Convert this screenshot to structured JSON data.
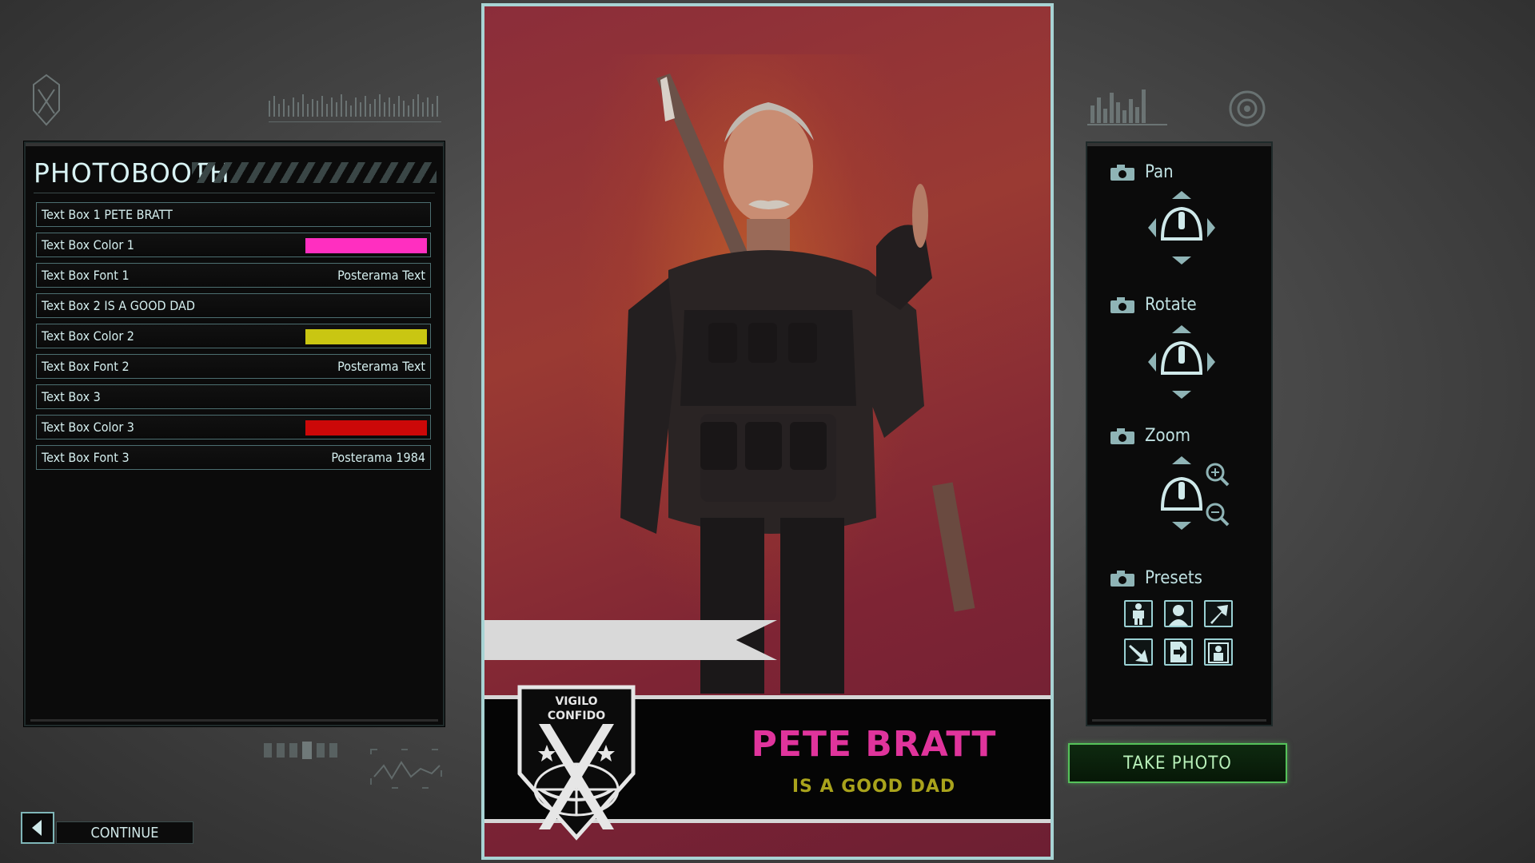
{
  "left_panel": {
    "title": "PHOTOBOOTH",
    "options": [
      {
        "label": "Text Box 1 PETE BRATT",
        "value": "",
        "swatch": ""
      },
      {
        "label": "Text Box Color 1",
        "value": "",
        "swatch": "#ff2fc0"
      },
      {
        "label": "Text Box Font 1",
        "value": "Posterama Text",
        "swatch": ""
      },
      {
        "label": "Text Box 2 IS A GOOD DAD",
        "value": "",
        "swatch": ""
      },
      {
        "label": "Text Box Color 2",
        "value": "",
        "swatch": "#c9c612"
      },
      {
        "label": "Text Box Font 2",
        "value": "Posterama Text",
        "swatch": ""
      },
      {
        "label": "Text Box 3",
        "value": "",
        "swatch": ""
      },
      {
        "label": "Text Box Color 3",
        "value": "",
        "swatch": "#cc0808"
      },
      {
        "label": "Text Box Font 3",
        "value": "Posterama 1984",
        "swatch": ""
      }
    ]
  },
  "card": {
    "name": "PETE BRATT",
    "subtitle": "IS A GOOD DAD",
    "seal_text_top": "VIGILO",
    "seal_text_bottom": "CONFIDO"
  },
  "right_panel": {
    "pan_label": "Pan",
    "rotate_label": "Rotate",
    "zoom_label": "Zoom",
    "presets_label": "Presets"
  },
  "actions": {
    "take_photo": "TAKE PHOTO",
    "continue": "CONTINUE"
  },
  "colors": {
    "accent": "#9ad1d4",
    "take_photo_green": "#55c25a",
    "card_border": "#a8d3d4"
  }
}
